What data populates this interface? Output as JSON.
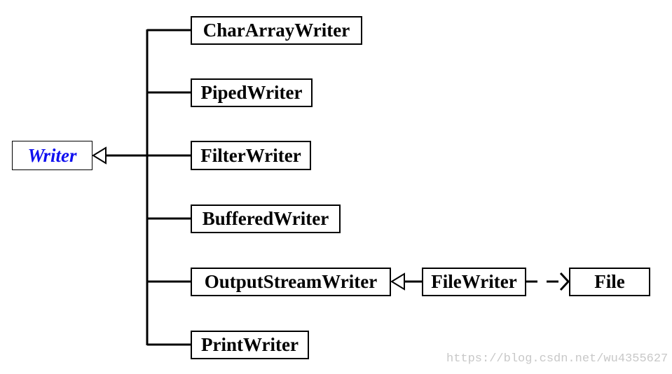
{
  "root": {
    "label": "Writer",
    "color": "#1010f0"
  },
  "subclasses": [
    {
      "label": "CharArrayWriter"
    },
    {
      "label": "PipedWriter"
    },
    {
      "label": "FilterWriter"
    },
    {
      "label": "BufferedWriter"
    },
    {
      "label": "OutputStreamWriter"
    },
    {
      "label": "PrintWriter"
    }
  ],
  "filewriter": {
    "label": "FileWriter"
  },
  "file": {
    "label": "File"
  },
  "watermark": "https://blog.csdn.net/wu4355627"
}
